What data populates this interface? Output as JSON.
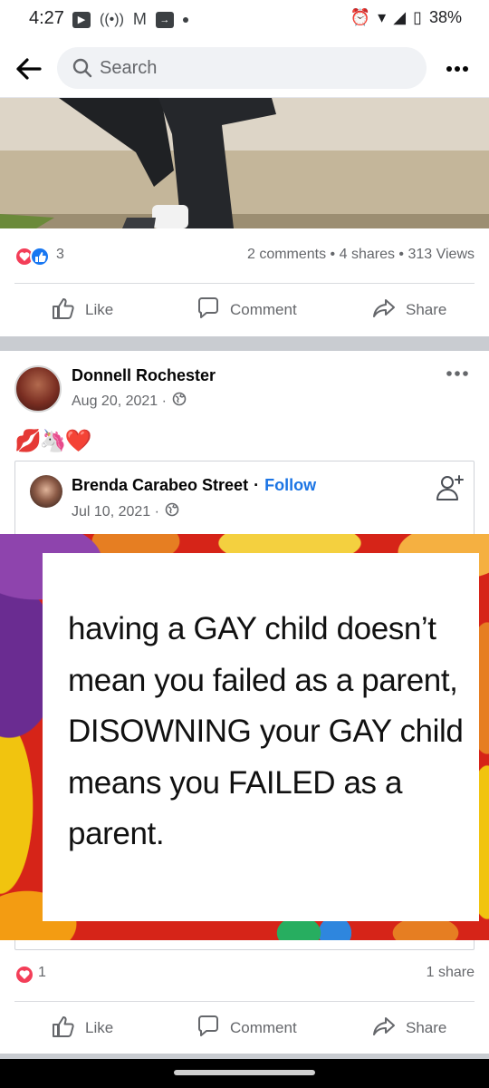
{
  "status_bar": {
    "time": "4:27",
    "battery": "38%",
    "icons_left": [
      "youtube-icon",
      "cast-icon",
      "gmail-icon",
      "forward-icon",
      "dot-icon"
    ],
    "icons_right": [
      "alarm-icon",
      "wifi-icon",
      "signal-icon",
      "battery-icon"
    ]
  },
  "header": {
    "search_placeholder": "Search",
    "back_icon": "back-arrow-icon",
    "more_icon": "more-dots-icon"
  },
  "post1": {
    "reaction_count": "3",
    "stats": "2 comments • 4 shares • 313 Views",
    "actions": {
      "like": "Like",
      "comment": "Comment",
      "share": "Share"
    }
  },
  "post2": {
    "author": "Donnell Rochester",
    "date": "Aug 20, 2021 ·",
    "text": "💋🦄❤️",
    "shared": {
      "author": "Brenda Carabeo Street",
      "dot": "·",
      "follow": "Follow",
      "date": "Jul 10, 2021 ·",
      "image_text": "having a GAY child doesn’t mean you failed as a parent, DISOWNING your GAY child means you FAILED as a parent."
    },
    "reaction_count": "1",
    "stats": "1 share",
    "actions": {
      "like": "Like",
      "comment": "Comment",
      "share": "Share"
    }
  },
  "colors": {
    "accent": "#1b74e4",
    "love": "#f33e58",
    "like": "#1877f2",
    "muted": "#65676b"
  }
}
